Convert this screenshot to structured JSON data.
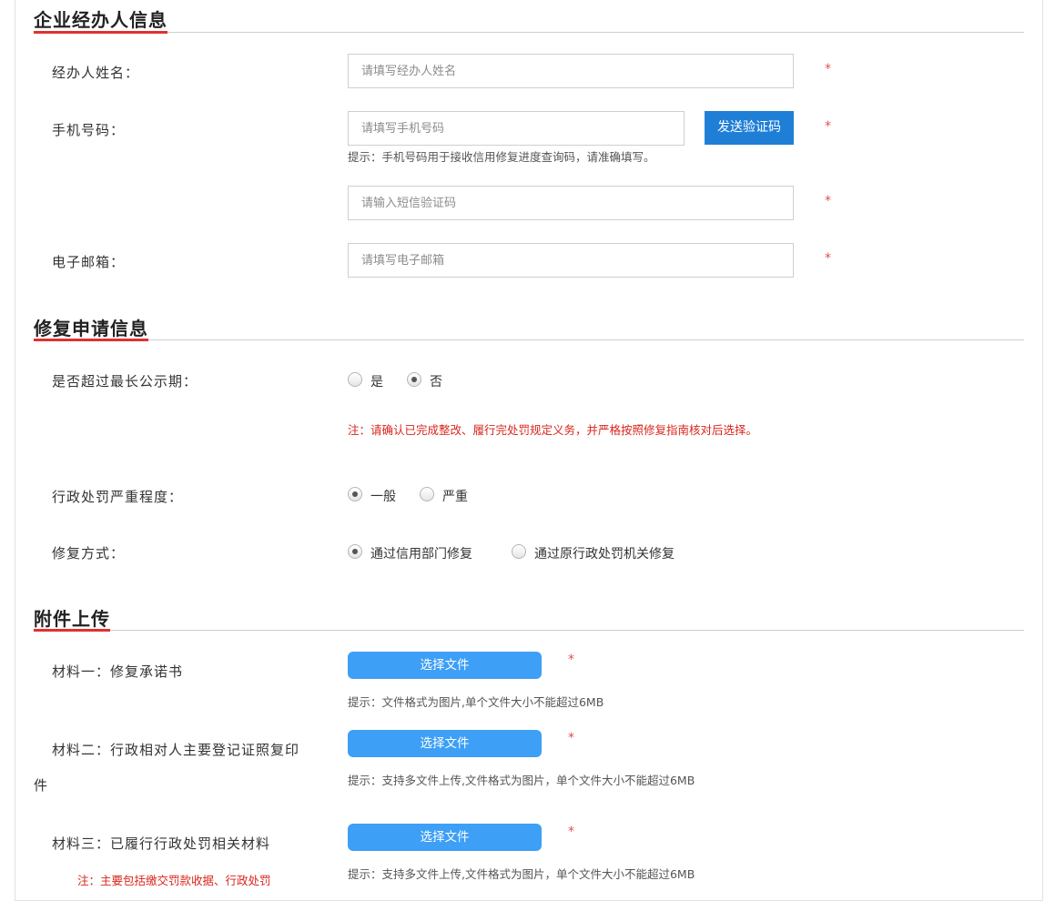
{
  "agent_section": {
    "title": "企业经办人信息",
    "name": {
      "label": "经办人姓名：",
      "placeholder": "请填写经办人姓名",
      "required": "*"
    },
    "phone": {
      "label": "手机号码：",
      "placeholder": "请填写手机号码",
      "send_code_label": "发送验证码",
      "required": "*",
      "hint": "提示：手机号码用于接收信用修复进度查询码，请准确填写。"
    },
    "sms_code": {
      "placeholder": "请输入短信验证码",
      "required": "*"
    },
    "email": {
      "label": "电子邮箱：",
      "placeholder": "请填写电子邮箱",
      "required": "*"
    }
  },
  "repair_section": {
    "title": "修复申请信息",
    "over_period": {
      "label": "是否超过最长公示期：",
      "options": [
        "是",
        "否"
      ],
      "selected": "否",
      "note": "注：请确认已完成整改、履行完处罚规定义务，并严格按照修复指南核对后选择。"
    },
    "severity": {
      "label": "行政处罚严重程度：",
      "options": [
        "一般",
        "严重"
      ],
      "selected": "一般"
    },
    "method": {
      "label": "修复方式：",
      "options": [
        "通过信用部门修复",
        "通过原行政处罚机关修复"
      ],
      "selected": "通过信用部门修复"
    }
  },
  "upload_section": {
    "title": "附件上传",
    "materials": [
      {
        "label": "材料一：修复承诺书",
        "button": "选择文件",
        "required": "*",
        "hint": "提示：文件格式为图片,单个文件大小不能超过6MB"
      },
      {
        "label_line1": "材料二：行政相对人主要登记证照复印",
        "label_line2": "件",
        "button": "选择文件",
        "required": "*",
        "hint": "提示：支持多文件上传,文件格式为图片，单个文件大小不能超过6MB"
      },
      {
        "label": "材料三：已履行行政处罚相关材料",
        "button": "选择文件",
        "required": "*",
        "hint": "提示：支持多文件上传,文件格式为图片，单个文件大小不能超过6MB",
        "note": "注：主要包括缴交罚款收据、行政处罚"
      }
    ]
  },
  "colors": {
    "accent_red": "#e0312f",
    "button_blue": "#1f7fd6",
    "file_button_blue": "#3d9ff5",
    "required_red": "#e84b4b"
  }
}
